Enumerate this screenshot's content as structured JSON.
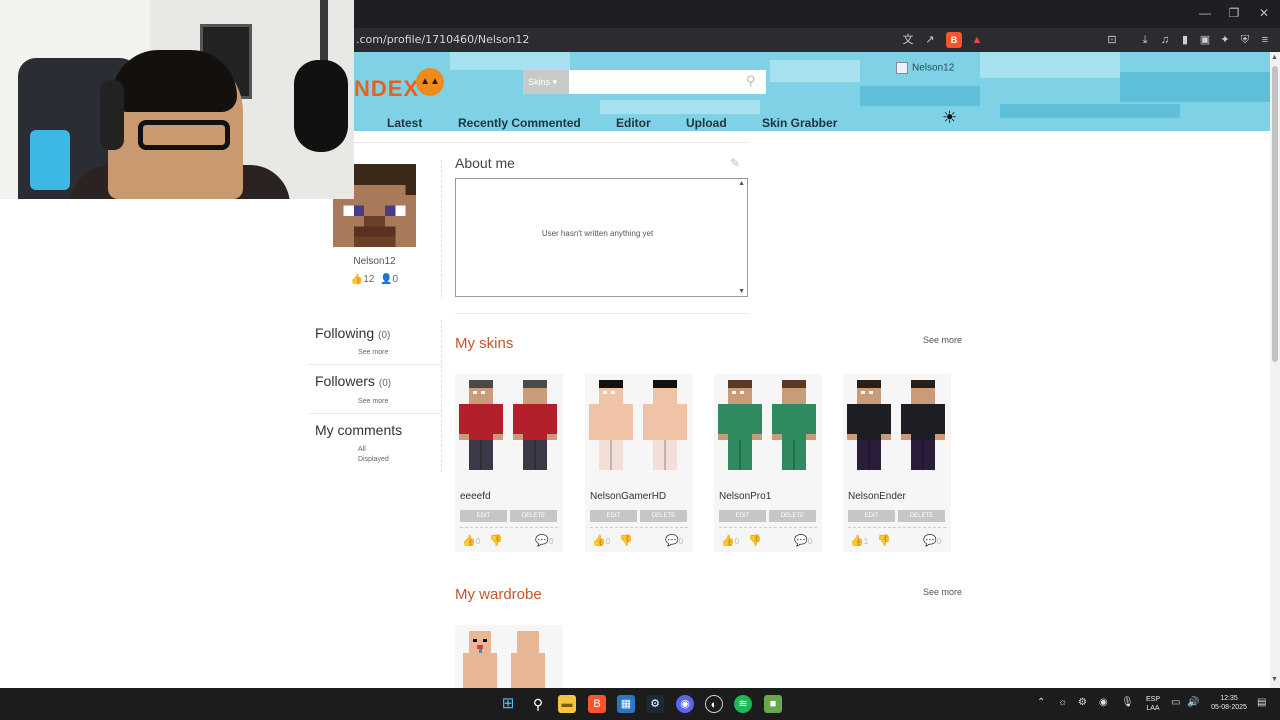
{
  "browser": {
    "url": ".com/profile/1710460/Nelson12"
  },
  "site": {
    "logo_text": "NDEX",
    "search_category": "Skins",
    "search_placeholder": "",
    "user_name": "Nelson12",
    "nav": [
      "Latest",
      "Recently Commented",
      "Editor",
      "Upload",
      "Skin Grabber"
    ]
  },
  "profile": {
    "username": "Nelson12",
    "likes": "12",
    "followers_count_icon": "0",
    "about_title": "About me",
    "about_text": "User hasn't written anything yet",
    "following_label": "Following",
    "following_count": "(0)",
    "following_see_more": "See more",
    "followers_label": "Followers",
    "followers_count": "(0)",
    "followers_see_more": "See more",
    "comments_label": "My comments",
    "comments_all": "All",
    "comments_displayed": "Displayed"
  },
  "my_skins": {
    "title": "My skins",
    "see_more": "See more",
    "edit_label": "EDIT",
    "delete_label": "DELETE",
    "items": [
      {
        "name": "eeeefd",
        "likes": "0",
        "dislikes": "",
        "comments": "0",
        "shirt": "#b3202b",
        "skin": "#c99b79",
        "hair": "#4a4a4a",
        "pants": "#3a3a48"
      },
      {
        "name": "NelsonGamerHD",
        "likes": "0",
        "dislikes": "",
        "comments": "0",
        "shirt": "#f0c3a6",
        "skin": "#f0c3a6",
        "hair": "#111111",
        "pants": "#f2e0d8"
      },
      {
        "name": "NelsonPro1",
        "likes": "0",
        "dislikes": "",
        "comments": "0",
        "shirt": "#2f8a5f",
        "skin": "#c99b79",
        "hair": "#5a3a24",
        "pants": "#2f8a5f"
      },
      {
        "name": "NelsonEnder",
        "likes": "1",
        "dislikes": "",
        "comments": "0",
        "shirt": "#1d1d24",
        "skin": "#c99b79",
        "hair": "#2a1f18",
        "pants": "#2c1e3a"
      }
    ]
  },
  "my_wardrobe": {
    "title": "My wardrobe",
    "see_more": "See more"
  },
  "taskbar": {
    "lang_top": "ESP",
    "lang_bottom": "LAA",
    "time": "12:35",
    "date": "05-08-2025"
  },
  "colors": {
    "accent": "#c8552b",
    "header": "#7fd1e6"
  }
}
